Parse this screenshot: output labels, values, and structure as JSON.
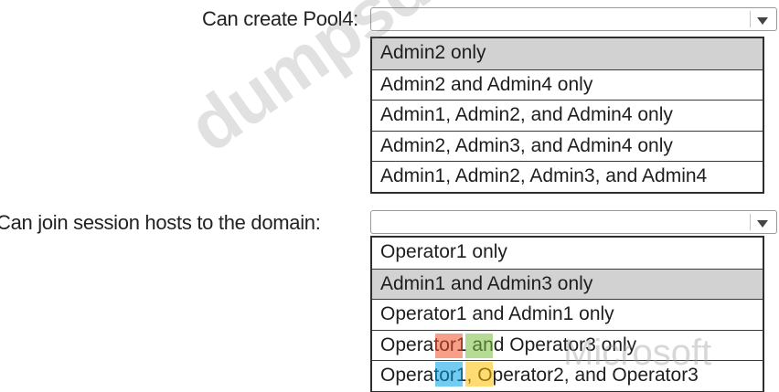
{
  "questions": [
    {
      "label": "Can create Pool4:",
      "selected_value": "",
      "options": [
        "Admin2 only",
        "Admin2 and Admin4 only",
        "Admin1, Admin2, and Admin4 only",
        "Admin2, Admin3, and Admin4 only",
        "Admin1, Admin2, Admin3, and Admin4"
      ],
      "highlighted_index": 0
    },
    {
      "label": "Can join session hosts to the domain:",
      "selected_value": "",
      "options": [
        "Operator1 only",
        "Admin1 and Admin3 only",
        "Operator1 and Admin1 only",
        "Operator1 and Operator3 only",
        "Operator1, Operator2, and Operator3"
      ],
      "highlighted_index": 1
    }
  ],
  "watermark": {
    "text": "dumpsdb.com",
    "logo_word": "Microsoft",
    "logo_colors": [
      "#f05028",
      "#78be3c",
      "#00a0e6",
      "#ffbe00"
    ]
  }
}
